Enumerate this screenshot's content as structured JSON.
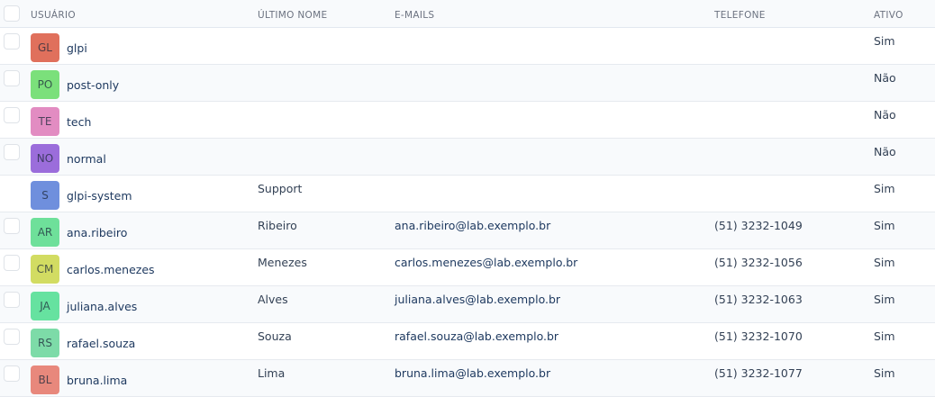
{
  "headers": {
    "user": "USUÁRIO",
    "last_name": "ÚLTIMO NOME",
    "emails": "E-MAILS",
    "phone": "TELEFONE",
    "active": "ATIVO"
  },
  "rows": [
    {
      "initials": "GL",
      "avatar_color": "#e0705c",
      "login": "glpi",
      "last_name": "",
      "email": "",
      "phone": "",
      "active": "Sim",
      "has_checkbox": true
    },
    {
      "initials": "PO",
      "avatar_color": "#7be07b",
      "login": "post-only",
      "last_name": "",
      "email": "",
      "phone": "",
      "active": "Não",
      "has_checkbox": true
    },
    {
      "initials": "TE",
      "avatar_color": "#e28cc2",
      "login": "tech",
      "last_name": "",
      "email": "",
      "phone": "",
      "active": "Não",
      "has_checkbox": true
    },
    {
      "initials": "NO",
      "avatar_color": "#9b6ddb",
      "login": "normal",
      "last_name": "",
      "email": "",
      "phone": "",
      "active": "Não",
      "has_checkbox": true
    },
    {
      "initials": "S",
      "avatar_color": "#6f8fdd",
      "login": "glpi-system",
      "last_name": "Support",
      "email": "",
      "phone": "",
      "active": "Sim",
      "has_checkbox": false
    },
    {
      "initials": "AR",
      "avatar_color": "#6ee09a",
      "login": "ana.ribeiro",
      "last_name": "Ribeiro",
      "email": "ana.ribeiro@lab.exemplo.br",
      "phone": "(51) 3232-1049",
      "active": "Sim",
      "has_checkbox": true
    },
    {
      "initials": "CM",
      "avatar_color": "#d2dc62",
      "login": "carlos.menezes",
      "last_name": "Menezes",
      "email": "carlos.menezes@lab.exemplo.br",
      "phone": "(51) 3232-1056",
      "active": "Sim",
      "has_checkbox": true
    },
    {
      "initials": "JA",
      "avatar_color": "#66e2a0",
      "login": "juliana.alves",
      "last_name": "Alves",
      "email": "juliana.alves@lab.exemplo.br",
      "phone": "(51) 3232-1063",
      "active": "Sim",
      "has_checkbox": true
    },
    {
      "initials": "RS",
      "avatar_color": "#7ddba8",
      "login": "rafael.souza",
      "last_name": "Souza",
      "email": "rafael.souza@lab.exemplo.br",
      "phone": "(51) 3232-1070",
      "active": "Sim",
      "has_checkbox": true
    },
    {
      "initials": "BL",
      "avatar_color": "#e8887c",
      "login": "bruna.lima",
      "last_name": "Lima",
      "email": "bruna.lima@lab.exemplo.br",
      "phone": "(51) 3232-1077",
      "active": "Sim",
      "has_checkbox": true
    }
  ]
}
